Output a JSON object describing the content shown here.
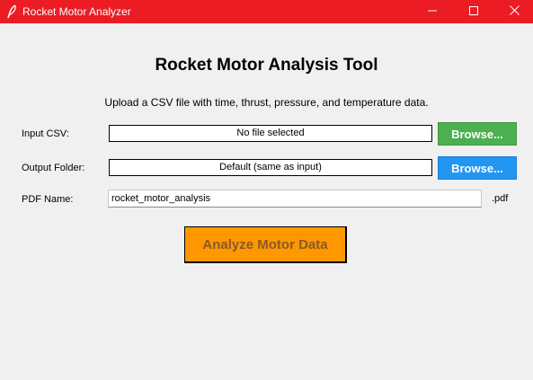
{
  "window": {
    "title": "Rocket Motor Analyzer",
    "titlebar_color": "#ec1c24",
    "icon": "feather-icon",
    "controls": [
      "minimize-icon",
      "maximize-icon",
      "close-icon"
    ]
  },
  "main": {
    "heading": "Rocket Motor Analysis Tool",
    "subtitle": "Upload a CSV file with time, thrust, pressure, and temperature data."
  },
  "input_csv": {
    "label": "Input CSV:",
    "value": "No file selected",
    "button_label": "Browse...",
    "button_color": "#4caf50"
  },
  "output_folder": {
    "label": "Output Folder:",
    "value": "Default (same as input)",
    "button_label": "Browse...",
    "button_color": "#2196f3"
  },
  "pdf_name": {
    "label": "PDF Name:",
    "value": "rocket_motor_analysis",
    "extension": ".pdf"
  },
  "analyze": {
    "label": "Analyze Motor Data",
    "color": "#ff9800"
  }
}
